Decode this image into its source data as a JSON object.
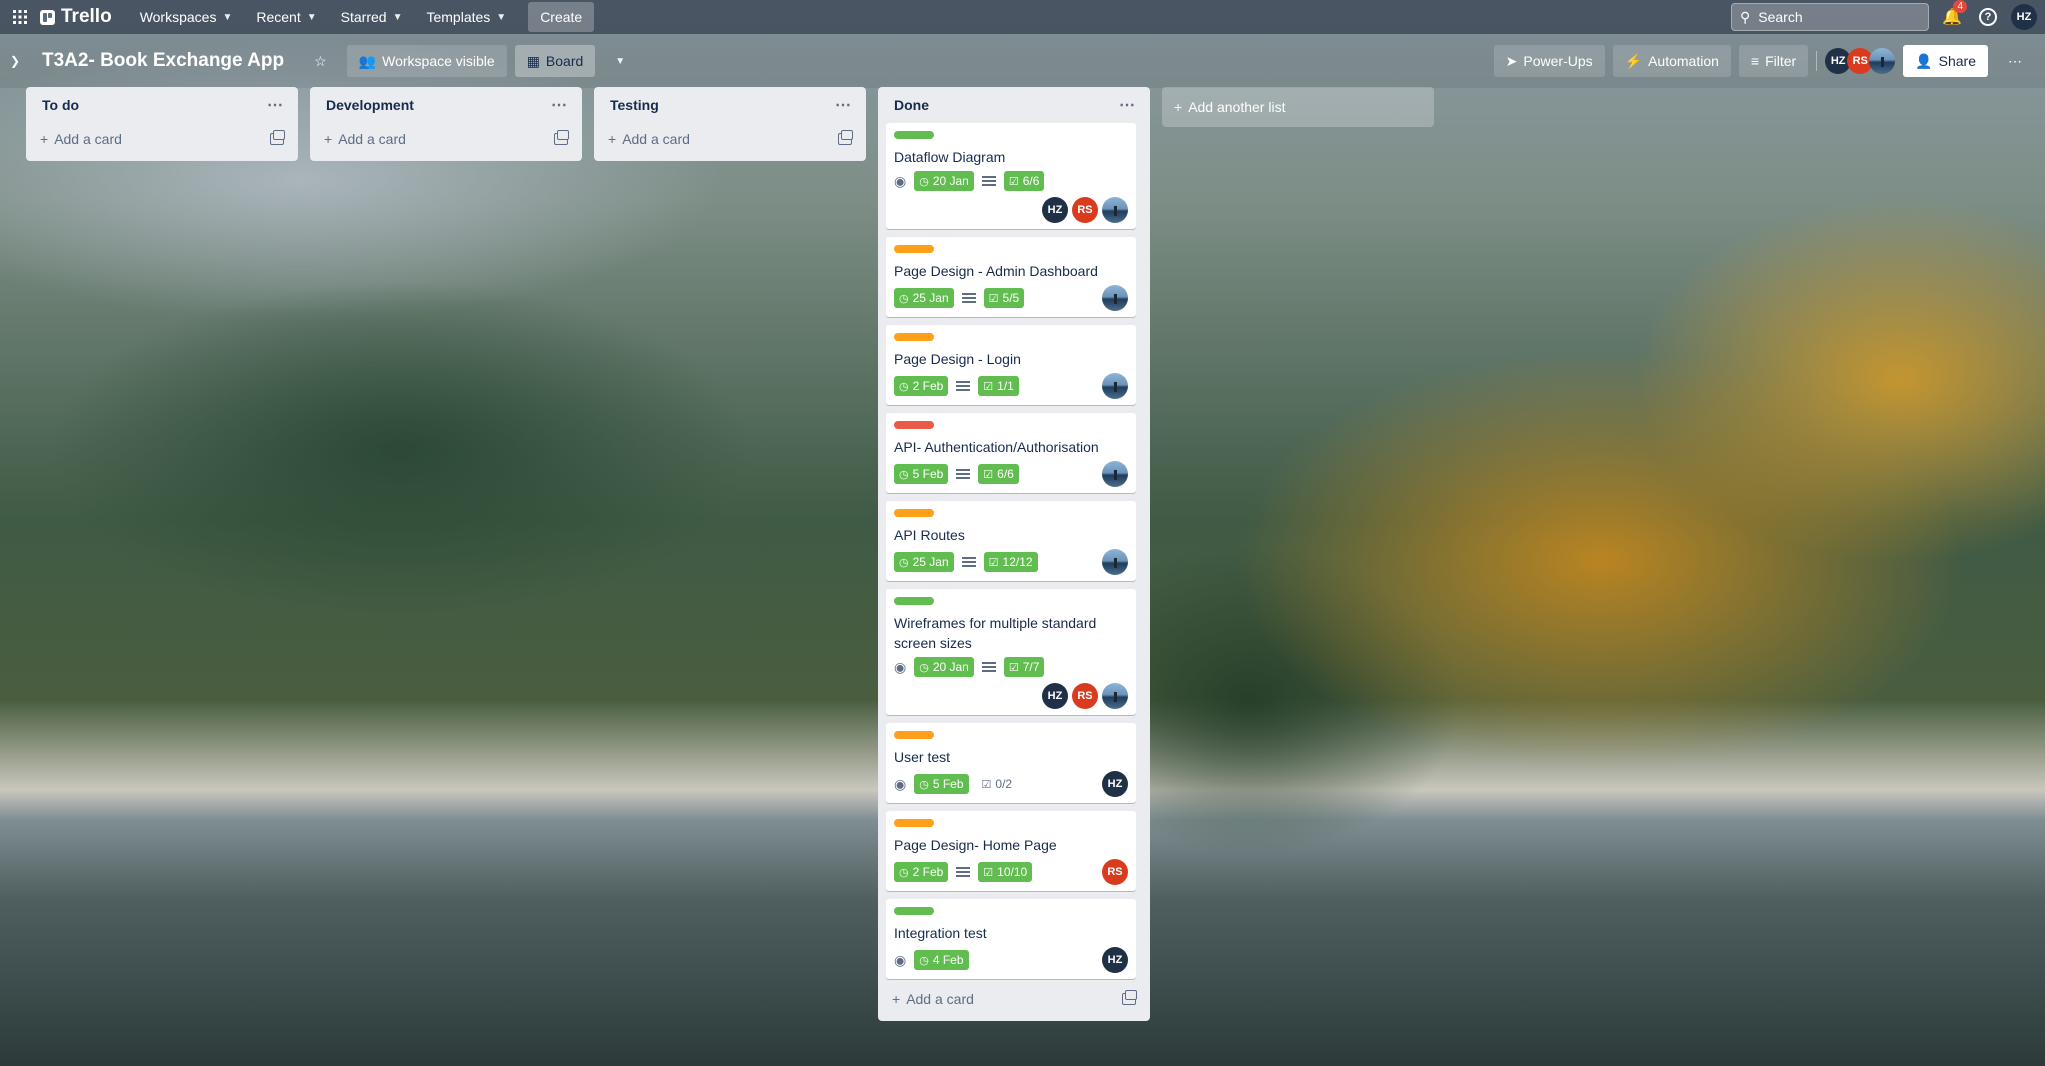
{
  "topbar": {
    "apps_icon": "grid-icon",
    "brand": "Trello",
    "nav": [
      {
        "label": "Workspaces"
      },
      {
        "label": "Recent"
      },
      {
        "label": "Starred"
      },
      {
        "label": "Templates"
      }
    ],
    "create_label": "Create",
    "search_placeholder": "Search",
    "notification_count": "4",
    "user_initials": "HZ"
  },
  "board": {
    "title": "T3A2- Book Exchange App",
    "visibility_label": "Workspace visible",
    "view_label": "Board",
    "powerups_label": "Power-Ups",
    "automation_label": "Automation",
    "filter_label": "Filter",
    "share_label": "Share",
    "members": [
      "HZ",
      "RS"
    ]
  },
  "colors": {
    "green": "#61bd4f",
    "orange": "#ff9f1a",
    "red": "#eb5a46"
  },
  "lists": [
    {
      "title": "To do",
      "add_card": "Add a card"
    },
    {
      "title": "Development",
      "add_card": "Add a card"
    },
    {
      "title": "Testing",
      "add_card": "Add a card"
    }
  ],
  "done_list": {
    "title": "Done",
    "add_card": "Add a card",
    "cards": [
      {
        "label_color": "#61bd4f",
        "title": "Dataflow Diagram",
        "watch": true,
        "due": "20 Jan",
        "desc": true,
        "checklist": "6/6",
        "checklist_done": true,
        "members": [
          "HZ",
          "RS",
          "photo"
        ]
      },
      {
        "label_color": "#ff9f1a",
        "title": "Page Design - Admin Dashboard",
        "watch": false,
        "due": "25 Jan",
        "desc": true,
        "checklist": "5/5",
        "checklist_done": true,
        "members": [
          "photo"
        ]
      },
      {
        "label_color": "#ff9f1a",
        "title": "Page Design - Login",
        "watch": false,
        "due": "2 Feb",
        "desc": true,
        "checklist": "1/1",
        "checklist_done": true,
        "members": [
          "photo"
        ]
      },
      {
        "label_color": "#eb5a46",
        "title": "API- Authentication/Authorisation",
        "watch": false,
        "due": "5 Feb",
        "desc": true,
        "checklist": "6/6",
        "checklist_done": true,
        "members": [
          "photo"
        ]
      },
      {
        "label_color": "#ff9f1a",
        "title": "API Routes",
        "watch": false,
        "due": "25 Jan",
        "desc": true,
        "checklist": "12/12",
        "checklist_done": true,
        "members": [
          "photo"
        ]
      },
      {
        "label_color": "#61bd4f",
        "title": "Wireframes for multiple standard screen sizes",
        "watch": true,
        "due": "20 Jan",
        "desc": true,
        "checklist": "7/7",
        "checklist_done": true,
        "members": [
          "HZ",
          "RS",
          "photo"
        ]
      },
      {
        "label_color": "#ff9f1a",
        "title": "User test",
        "watch": true,
        "due": "5 Feb",
        "desc": false,
        "checklist": "0/2",
        "checklist_done": false,
        "members": [
          "HZ"
        ]
      },
      {
        "label_color": "#ff9f1a",
        "title": "Page Design- Home Page",
        "watch": false,
        "due": "2 Feb",
        "desc": true,
        "checklist": "10/10",
        "checklist_done": true,
        "members": [
          "RS"
        ]
      },
      {
        "label_color": "#61bd4f",
        "title": "Integration test",
        "watch": true,
        "due": "4 Feb",
        "desc": false,
        "checklist": "",
        "checklist_done": false,
        "members": [
          "HZ"
        ]
      }
    ]
  },
  "add_list_label": "Add another list"
}
